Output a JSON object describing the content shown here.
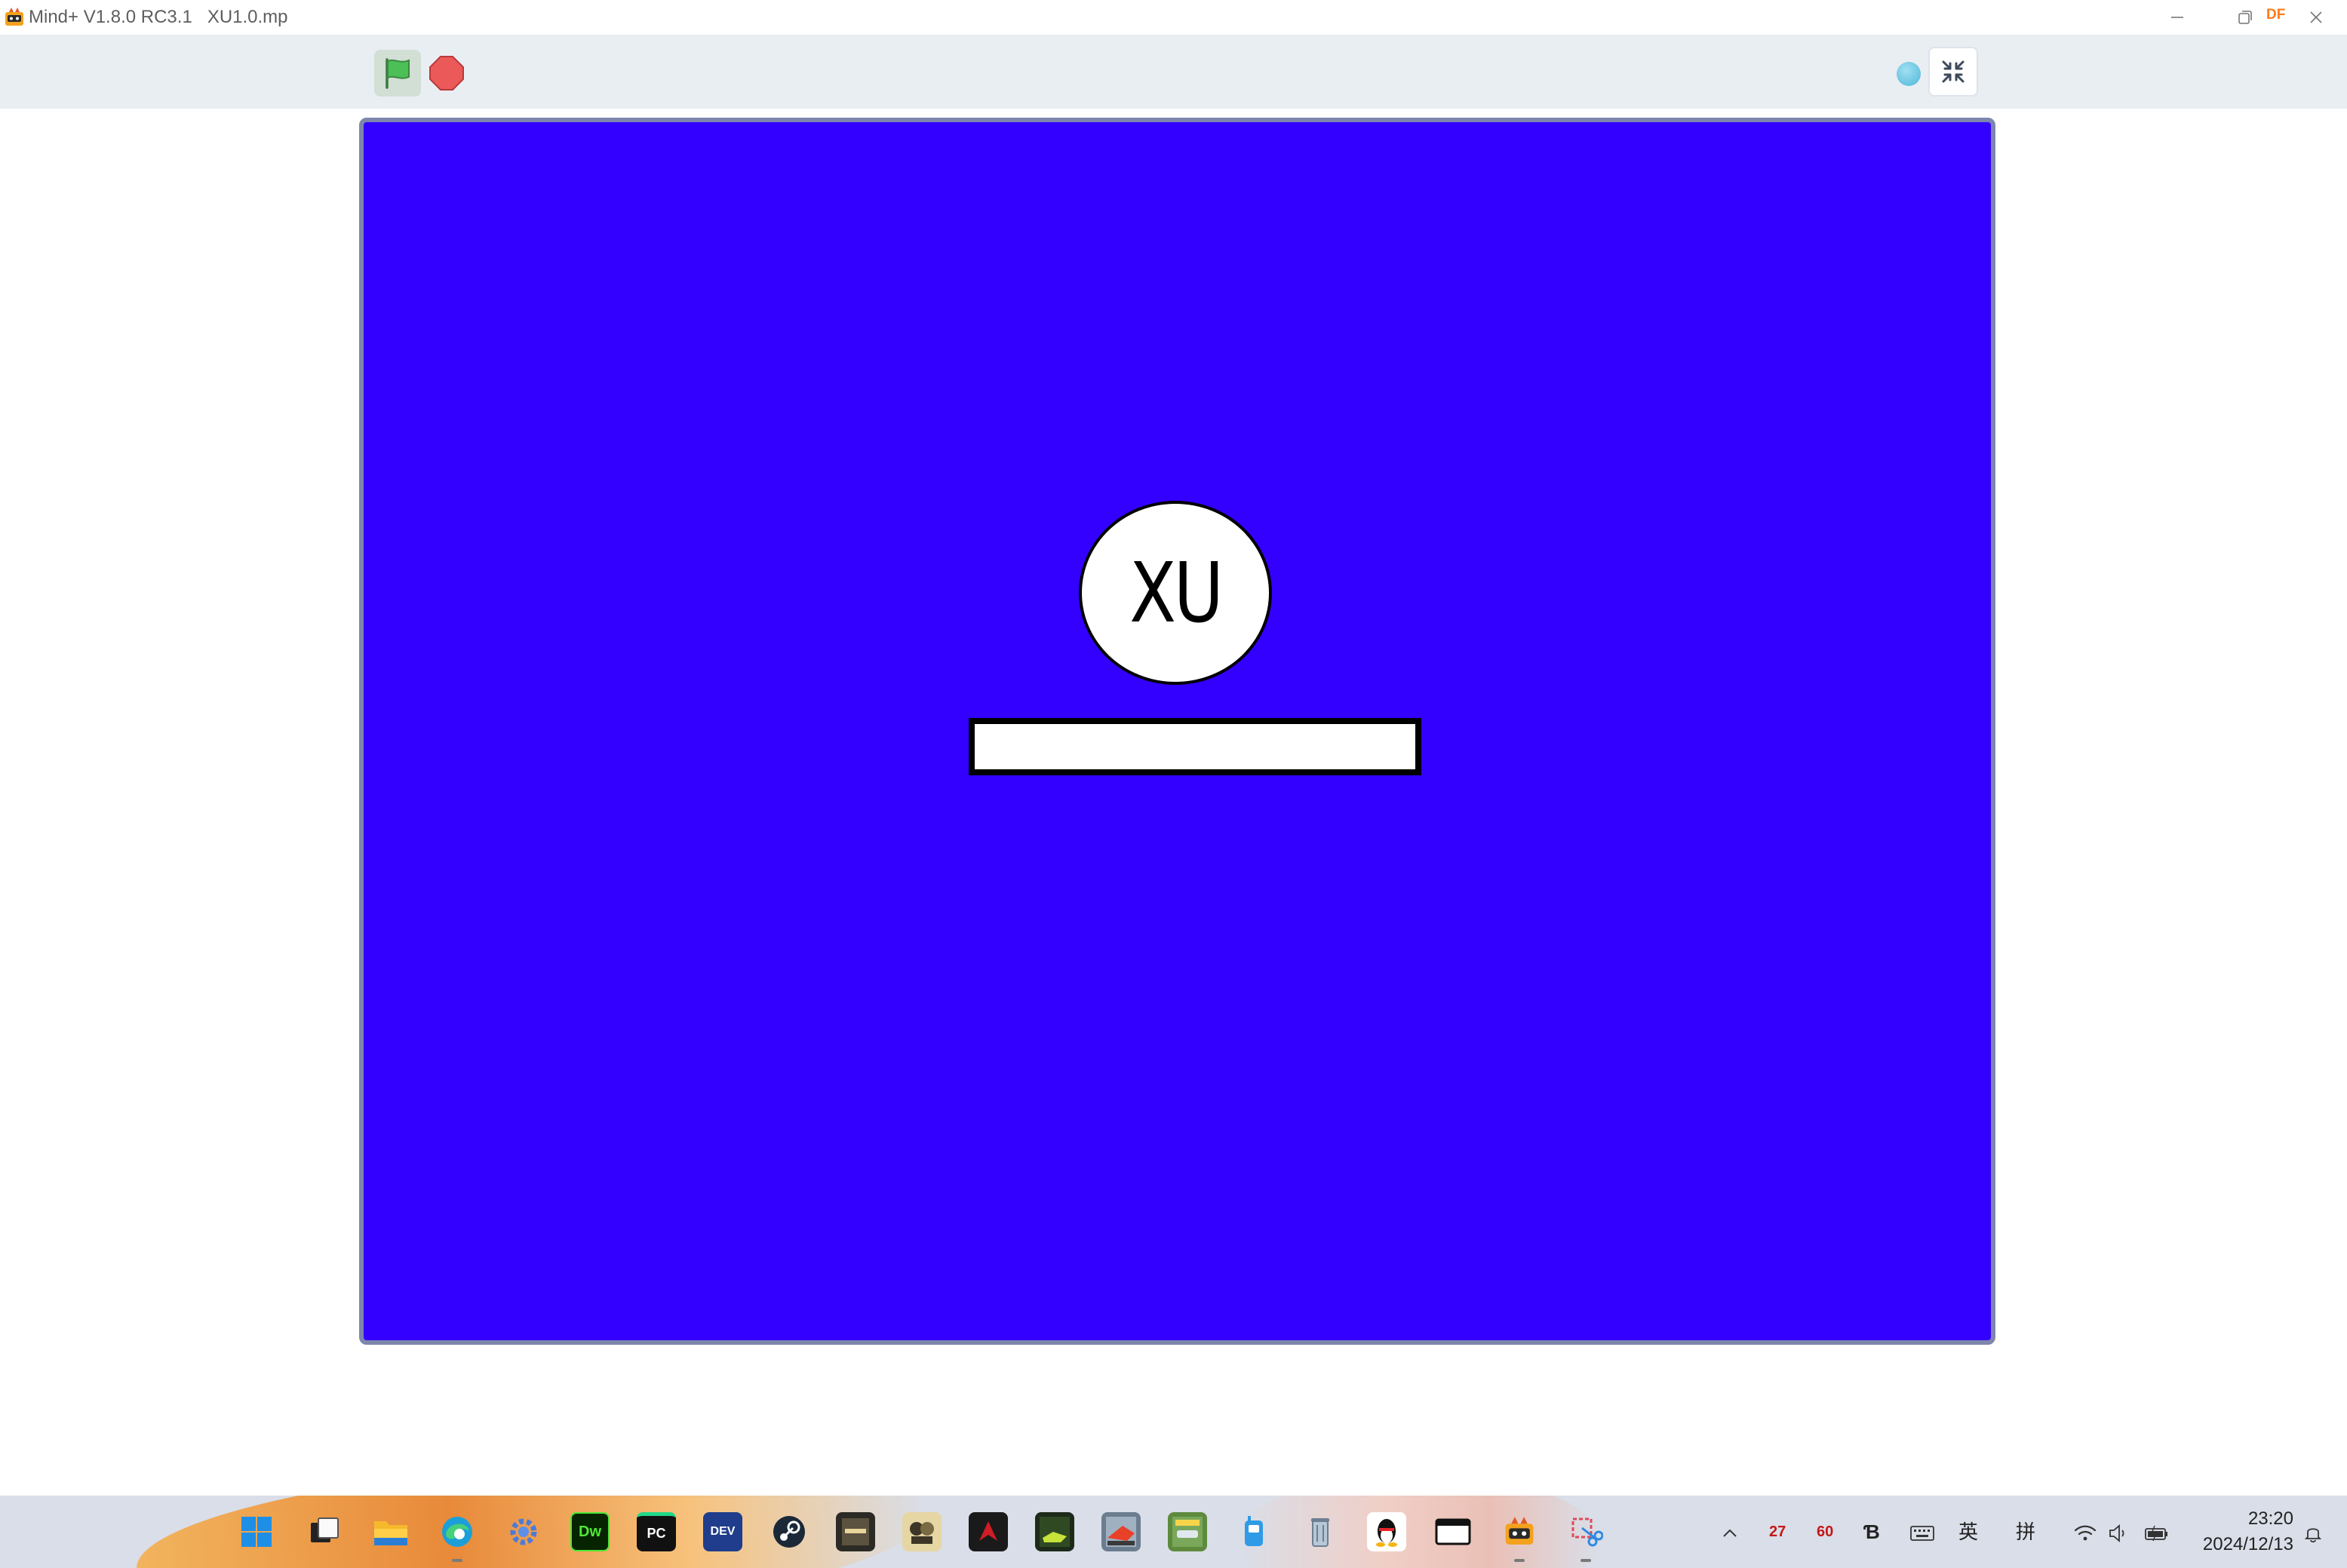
{
  "window": {
    "app_name": "Mind+ V1.8.0 RC3.1",
    "file_name": "XU1.0.mp",
    "minimize_icon": "minimize-icon",
    "restore_icon": "restore-icon",
    "close_icon": "close-icon",
    "badge": "DF"
  },
  "toolbar": {
    "green_flag_icon": "green-flag-icon",
    "stop_icon": "stop-sign-icon",
    "status_icon": "connection-status-icon",
    "shrink_icon": "shrink-stage-icon"
  },
  "stage": {
    "background_color": "#3300ff",
    "sprite_label": "XU",
    "answer_input_value": ""
  },
  "taskbar": {
    "pinned": [
      {
        "name": "start-icon",
        "glyph": ""
      },
      {
        "name": "task-view-icon",
        "glyph": ""
      },
      {
        "name": "file-explorer-icon",
        "glyph": ""
      },
      {
        "name": "edge-icon",
        "glyph": ""
      },
      {
        "name": "settings-gear-icon",
        "glyph": ""
      },
      {
        "name": "dreamweaver-icon",
        "glyph": "Dw"
      },
      {
        "name": "pycharm-icon",
        "glyph": "PC"
      },
      {
        "name": "dev-cpp-icon",
        "glyph": "DEV"
      },
      {
        "name": "steam-icon",
        "glyph": ""
      },
      {
        "name": "call-of-duty-icon",
        "glyph": ""
      },
      {
        "name": "game-icon",
        "glyph": ""
      },
      {
        "name": "red-app-icon",
        "glyph": ""
      },
      {
        "name": "racing-game-icon",
        "glyph": ""
      },
      {
        "name": "war-game-icon",
        "glyph": ""
      },
      {
        "name": "car-game-icon",
        "glyph": ""
      },
      {
        "name": "walkie-app-icon",
        "glyph": ""
      },
      {
        "name": "recycle-bin-icon",
        "glyph": ""
      },
      {
        "name": "qq-penguin-icon",
        "glyph": ""
      },
      {
        "name": "window-app-icon",
        "glyph": ""
      },
      {
        "name": "mindplus-icon",
        "glyph": ""
      },
      {
        "name": "snipping-tool-icon",
        "glyph": ""
      }
    ],
    "tray": {
      "chevron_icon": "chevron-up-icon",
      "temp_cpu": "27",
      "temp_gpu": "60",
      "ime_mode": "英",
      "ime_pinyin": "拼",
      "wifi_icon": "wifi-icon",
      "volume_icon": "volume-icon",
      "battery_icon": "battery-icon",
      "notification_icon": "bell-icon"
    },
    "clock": {
      "time": "23:20",
      "date": "2024/12/13"
    }
  }
}
